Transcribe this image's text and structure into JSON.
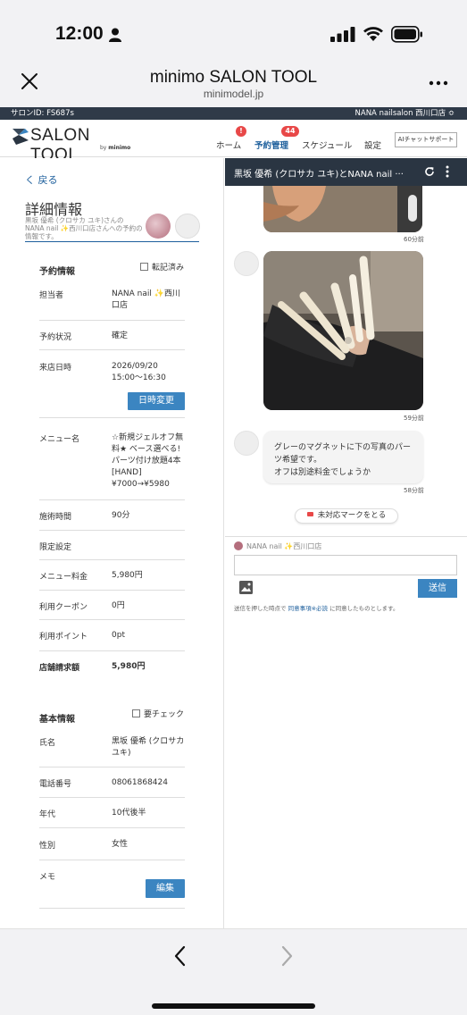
{
  "status_bar": {
    "time": "12:00"
  },
  "browser": {
    "title": "minimo SALON TOOL",
    "url": "minimodel.jp"
  },
  "salon_bar": {
    "salon_id": "サロンID: FS687s",
    "store": "NANA  nailsalon 西川口店 ≎"
  },
  "header": {
    "logo_text": "SALON TOOL",
    "logo_by": "by",
    "logo_brand": "minimo",
    "nav": [
      {
        "label": "ホーム",
        "badge": "!"
      },
      {
        "label": "予約管理",
        "badge": "44"
      },
      {
        "label": "スケジュール",
        "badge": ""
      },
      {
        "label": "設定",
        "badge": ""
      }
    ],
    "ai_button": "AIチャットサポート"
  },
  "detail": {
    "back": "く 戻る",
    "title": "詳細情報",
    "subtitle_line1": "黒坂 優希 (クロサカ ユキ)さんの",
    "subtitle_line2": "NANA nail ✨西川口店さんへの予約の",
    "subtitle_line3": "情報です。",
    "reservation": {
      "heading": "予約情報",
      "checkbox_label": "転記済み",
      "rows": [
        {
          "label": "担当者",
          "value": "NANA nail ✨西川口店"
        },
        {
          "label": "予約状況",
          "value": "確定"
        },
        {
          "label": "来店日時",
          "value": "2026/09/20 15:00〜16:30"
        },
        {
          "label": "メニュー名",
          "value": "☆新規ジェルオフ無料★ ベース選べる! パーツ付け放題4本[HAND] ¥7000→¥5980"
        },
        {
          "label": "施術時間",
          "value": "90分"
        },
        {
          "label": "限定設定",
          "value": ""
        },
        {
          "label": "メニュー料金",
          "value": "5,980円"
        },
        {
          "label": "利用クーポン",
          "value": "0円"
        },
        {
          "label": "利用ポイント",
          "value": "0pt"
        },
        {
          "label": "店舗請求額",
          "value": "5,980円"
        }
      ],
      "change_button": "日時変更"
    },
    "basic": {
      "heading": "基本情報",
      "checkbox_label": "要チェック",
      "rows": [
        {
          "label": "氏名",
          "value": "黒坂 優希 (クロサカ ユキ)"
        },
        {
          "label": "電話番号",
          "value": "08061868424"
        },
        {
          "label": "年代",
          "value": "10代後半"
        },
        {
          "label": "性別",
          "value": "女性"
        },
        {
          "label": "メモ",
          "value": ""
        }
      ],
      "edit_button": "編集"
    }
  },
  "chat": {
    "title": "黒坂 優希 (クロサカ ユキ)とNANA nail ···",
    "messages": [
      {
        "time": "60分前"
      },
      {
        "time": "59分前"
      },
      {
        "text_line1": "グレーのマグネットに下の写真のパー",
        "text_line2": "ツ希望です。",
        "text_line3": "オフは別途料金でしょうか",
        "time": "58分前"
      }
    ],
    "mark_button": "未対応マークをとる",
    "sender": "NANA nail ✨西川口店",
    "input_placeholder": "",
    "send_button": "送信",
    "notice_prefix": "送信を押した時点で",
    "notice_link": "同意事項※必読",
    "notice_suffix": "に同意したものとします。"
  },
  "colors": {
    "accent": "#3b85c1",
    "dark_bar": "#2a3542",
    "badge": "#e84848"
  }
}
